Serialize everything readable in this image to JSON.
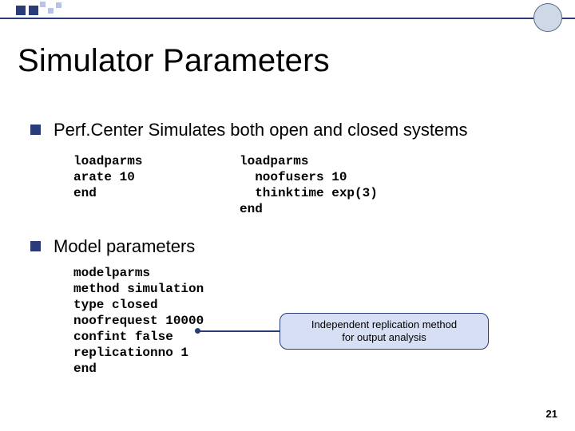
{
  "title": "Simulator Parameters",
  "bullets": {
    "b1": "Perf.Center Simulates both open and closed systems",
    "b2": "Model parameters"
  },
  "code": {
    "open": "loadparms\narate 10\nend",
    "closed": "loadparms\n  noofusers 10\n  thinktime exp(3)\nend",
    "model": "modelparms\nmethod simulation\ntype closed\nnoofrequest 10000\nconfint false\nreplicationno 1\nend"
  },
  "callout": {
    "line1": "Independent replication method",
    "line2": "for output analysis"
  },
  "page_number": "21"
}
